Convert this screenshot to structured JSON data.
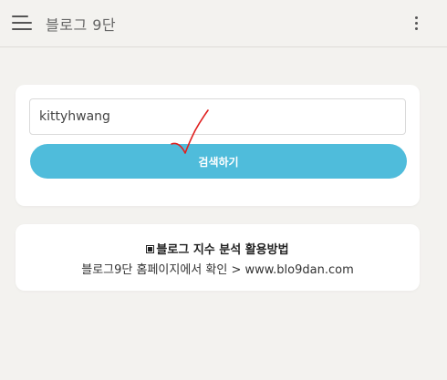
{
  "header": {
    "title": "블로그 9단"
  },
  "search": {
    "input_value": "kittyhwang",
    "button_label": "검색하기"
  },
  "info": {
    "title": "블로그 지수 분석 활용방법",
    "link_text": "블로그9단 홈페이지에서 확인 > www.blo9dan.com"
  },
  "colors": {
    "background": "#f3f2ef",
    "accent": "#4fbcdb",
    "annotation": "#e0201f"
  }
}
